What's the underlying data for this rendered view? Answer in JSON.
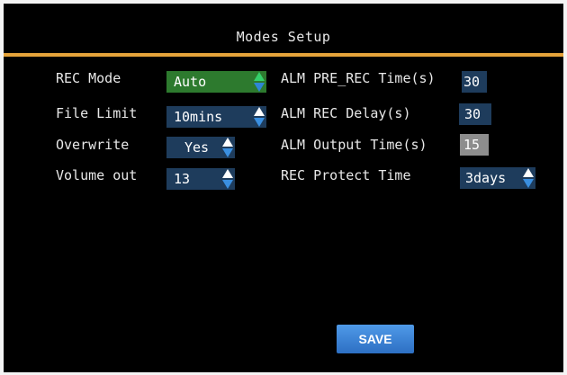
{
  "header": {
    "title": "Modes Setup"
  },
  "left": {
    "rec_mode": {
      "label": "REC Mode",
      "value": "Auto"
    },
    "file_limit": {
      "label": "File Limit",
      "value": "10mins"
    },
    "overwrite": {
      "label": "Overwrite",
      "value": "Yes"
    },
    "volume_out": {
      "label": "Volume out",
      "value": "13"
    }
  },
  "right": {
    "alm_pre_rec": {
      "label": "ALM PRE_REC Time(s)",
      "value": "30"
    },
    "alm_rec_delay": {
      "label": "ALM REC Delay(s)",
      "value": "30"
    },
    "alm_output": {
      "label": "ALM Output Time(s)",
      "value": "15"
    },
    "rec_protect": {
      "label": "REC Protect Time",
      "value": "3days"
    }
  },
  "save_button": {
    "label": "SAVE"
  },
  "colors": {
    "accent": "#e5a33a",
    "field_green": "#2d7a2e",
    "field_blue": "#1e3c5c",
    "field_gray": "#8d8d8d",
    "button_blue": "#2d6fc3"
  }
}
